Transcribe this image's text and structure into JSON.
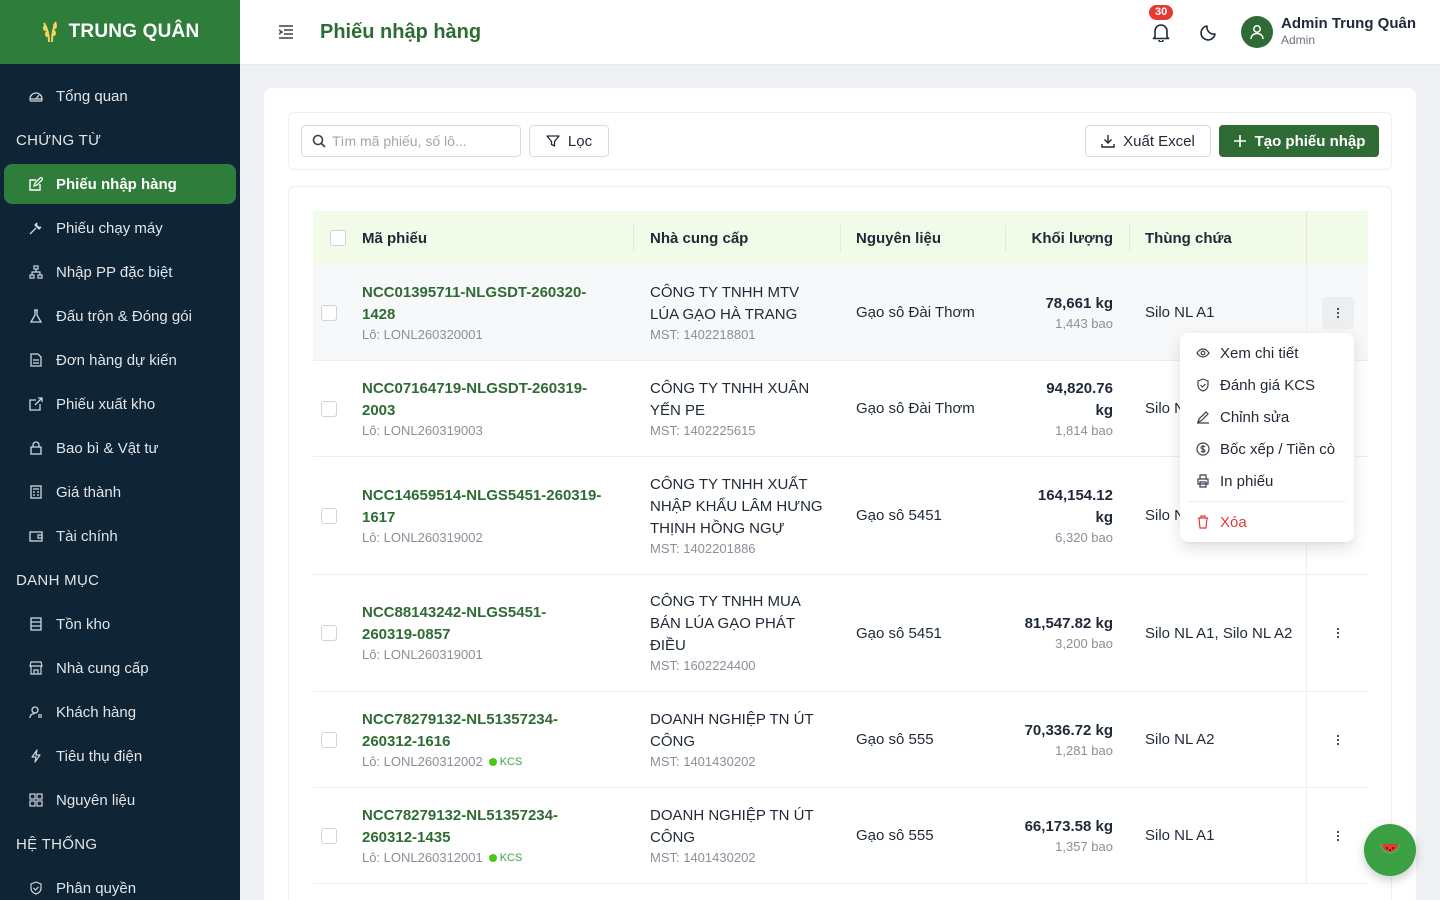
{
  "brand": {
    "name": "TRUNG QUÂN"
  },
  "sidebar": {
    "items": [
      {
        "label": "Tổng quan",
        "icon": "dashboard-icon"
      },
      {
        "section": "CHỨNG TỪ"
      },
      {
        "label": "Phiếu nhập hàng",
        "icon": "edit-doc-icon",
        "active": true
      },
      {
        "label": "Phiếu chạy máy",
        "icon": "tool-icon"
      },
      {
        "label": "Nhập PP đặc biệt",
        "icon": "network-icon"
      },
      {
        "label": "Đấu trộn & Đóng gói",
        "icon": "flask-icon"
      },
      {
        "label": "Đơn hàng dự kiến",
        "icon": "file-text-icon"
      },
      {
        "label": "Phiếu xuất kho",
        "icon": "export-doc-icon"
      },
      {
        "label": "Bao bì & Vật tư",
        "icon": "lock-icon"
      },
      {
        "label": "Giá thành",
        "icon": "calculator-icon"
      },
      {
        "label": "Tài chính",
        "icon": "wallet-icon"
      },
      {
        "section": "DANH MỤC"
      },
      {
        "label": "Tồn kho",
        "icon": "database-icon"
      },
      {
        "label": "Nhà cung cấp",
        "icon": "shop-icon"
      },
      {
        "label": "Khách hàng",
        "icon": "contacts-icon"
      },
      {
        "label": "Tiêu thụ điện",
        "icon": "thunderbolt-icon"
      },
      {
        "label": "Nguyên liệu",
        "icon": "appstore-icon"
      },
      {
        "section": "HỆ THỐNG"
      },
      {
        "label": "Phân quyền",
        "icon": "safety-icon"
      }
    ]
  },
  "header": {
    "title": "Phiếu nhập hàng",
    "notification_count": "30",
    "user_name": "Admin Trung Quân",
    "user_role": "Admin"
  },
  "toolbar": {
    "search_placeholder": "Tìm mã phiếu, số lô...",
    "filter_label": "Lọc",
    "export_label": "Xuất Excel",
    "create_label": "Tạo phiếu nhập"
  },
  "table": {
    "columns": [
      "Mã phiếu",
      "Nhà cung cấp",
      "Nguyên liệu",
      "Khối lượng",
      "Thùng chứa"
    ],
    "rows": [
      {
        "code_lines": [
          "NCC01395711-NLGSDT-260320-",
          "1428"
        ],
        "lot": "Lô: LONL260320001",
        "kcs": false,
        "supplier_lines": [
          "CÔNG TY TNHH MTV",
          "LÚA GẠO HÀ TRANG"
        ],
        "mst": "MST: 1402218801",
        "material": "Gạo sô Đài Thơm",
        "weight_lines": [
          "78,661 kg"
        ],
        "bags": "1,443 bao",
        "bin": "Silo NL A1"
      },
      {
        "code_lines": [
          "NCC07164719-NLGSDT-260319-",
          "2003"
        ],
        "lot": "Lô: LONL260319003",
        "kcs": false,
        "supplier_lines": [
          "CÔNG TY TNHH XUÂN",
          "YẾN PE"
        ],
        "mst": "MST: 1402225615",
        "material": "Gạo sô Đài Thơm",
        "weight_lines": [
          "94,820.76",
          "kg"
        ],
        "bags": "1,814 bao",
        "bin": "Silo N"
      },
      {
        "code_lines": [
          "NCC14659514-NLGS5451-260319-",
          "1617"
        ],
        "lot": "Lô: LONL260319002",
        "kcs": false,
        "supplier_lines": [
          "CÔNG TY TNHH XUẤT",
          "NHẬP KHẨU LÂM HƯNG",
          "THỊNH HỒNG NGỰ"
        ],
        "mst": "MST: 1402201886",
        "material": "Gạo sô 5451",
        "weight_lines": [
          "164,154.12",
          "kg"
        ],
        "bags": "6,320 bao",
        "bin": "Silo N"
      },
      {
        "code_lines": [
          "NCC88143242-NLGS5451-",
          "260319-0857"
        ],
        "lot": "Lô: LONL260319001",
        "kcs": false,
        "supplier_lines": [
          "CÔNG TY TNHH MUA",
          "BÁN LÚA GẠO PHÁT",
          "ĐIỀU"
        ],
        "mst": "MST: 1602224400",
        "material": "Gạo sô 5451",
        "weight_lines": [
          "81,547.82 kg"
        ],
        "bags": "3,200 bao",
        "bin": "Silo NL A1, Silo NL A2"
      },
      {
        "code_lines": [
          "NCC78279132-NL51357234-",
          "260312-1616"
        ],
        "lot": "Lô: LONL260312002",
        "kcs": true,
        "kcs_label": "KCS",
        "supplier_lines": [
          "DOANH NGHIỆP TN ÚT",
          "CÔNG"
        ],
        "mst": "MST: 1401430202",
        "material": "Gạo sô 555",
        "weight_lines": [
          "70,336.72 kg"
        ],
        "bags": "1,281 bao",
        "bin": "Silo NL A2"
      },
      {
        "code_lines": [
          "NCC78279132-NL51357234-",
          "260312-1435"
        ],
        "lot": "Lô: LONL260312001",
        "kcs": true,
        "kcs_label": "KCS",
        "supplier_lines": [
          "DOANH NGHIỆP TN ÚT",
          "CÔNG"
        ],
        "mst": "MST: 1401430202",
        "material": "Gạo sô 555",
        "weight_lines": [
          "66,173.58 kg"
        ],
        "bags": "1,357 bao",
        "bin": "Silo NL A1"
      }
    ]
  },
  "row_menu": {
    "items": [
      {
        "label": "Xem chi tiết",
        "icon": "eye-icon"
      },
      {
        "label": "Đánh giá KCS",
        "icon": "safety-check-icon"
      },
      {
        "label": "Chỉnh sửa",
        "icon": "edit-icon"
      },
      {
        "label": "Bốc xếp / Tiền cò",
        "icon": "dollar-icon"
      },
      {
        "label": "In phiếu",
        "icon": "printer-icon"
      }
    ],
    "danger_item": {
      "label": "Xóa",
      "icon": "delete-icon"
    }
  },
  "fab": {
    "icon": "watermelon-icon"
  },
  "colors": {
    "primary": "#2f6b34",
    "sidebar": "#0f2434",
    "active": "#2f7d3a",
    "header_row": "#f1fbe8",
    "danger": "#e53935"
  }
}
